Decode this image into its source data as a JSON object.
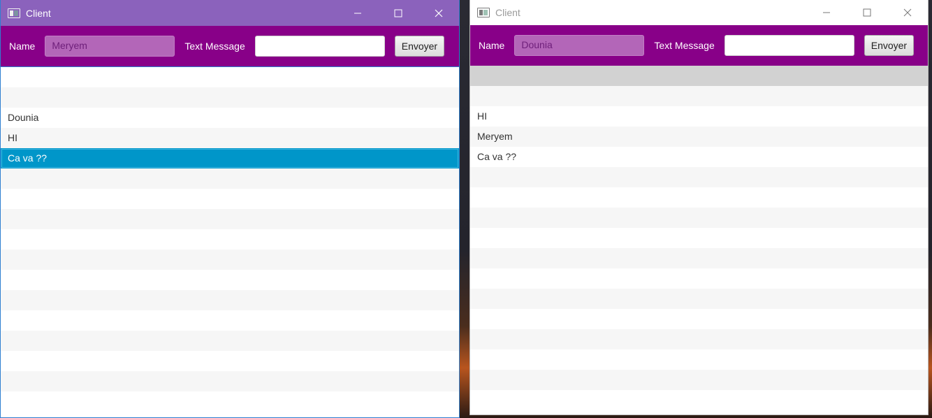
{
  "left_window": {
    "title": "Client",
    "toolbar": {
      "name_label": "Name",
      "name_value": "Meryem",
      "message_label": "Text Message",
      "message_value": "",
      "send_label": "Envoyer"
    },
    "messages": [
      "",
      "",
      "Dounia",
      "HI",
      "Ca va ??",
      "",
      "",
      "",
      "",
      "",
      "",
      "",
      "",
      "",
      "",
      "",
      ""
    ],
    "selected_index": 4
  },
  "right_window": {
    "title": "Client",
    "toolbar": {
      "name_label": "Name",
      "name_value": "Dounia",
      "message_label": "Text Message",
      "message_value": "",
      "send_label": "Envoyer"
    },
    "messages": [
      "",
      "",
      "HI",
      "Meryem",
      "Ca va ??",
      "",
      "",
      "",
      "",
      "",
      "",
      "",
      "",
      "",
      "",
      "",
      ""
    ]
  },
  "colors": {
    "titlebar_active": "#8b62bc",
    "toolbar": "#880088",
    "selection": "#0096c9"
  },
  "icons": [
    "app-icon",
    "minimize-icon",
    "maximize-icon",
    "close-icon"
  ]
}
